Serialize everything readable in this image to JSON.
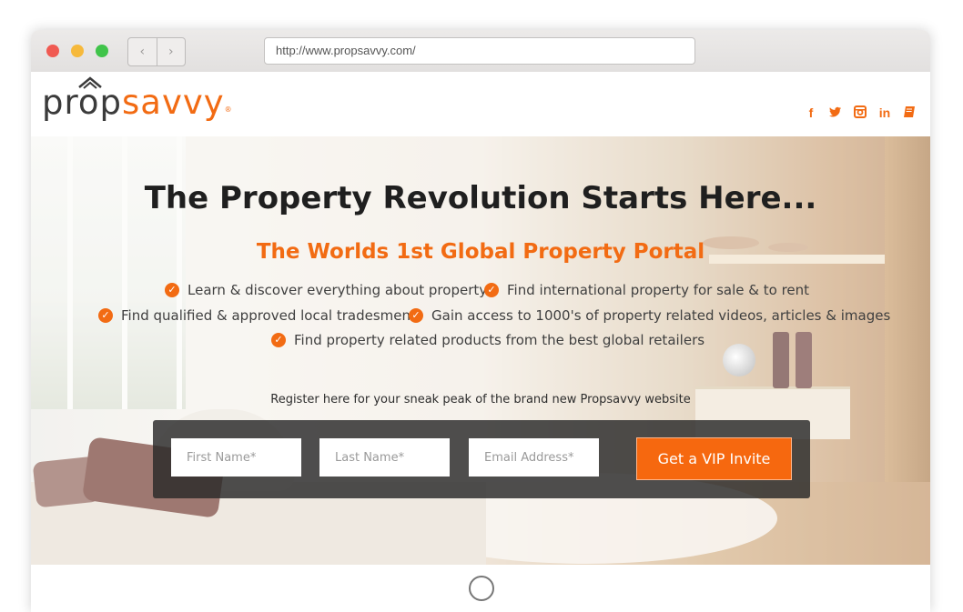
{
  "browser": {
    "url": "http://www.propsavvy.com/",
    "back_glyph": "‹",
    "forward_glyph": "›"
  },
  "site": {
    "logo_part1": "prop",
    "logo_part2": "savvy",
    "logo_mark": "®",
    "brand_color": "#f26b13",
    "social": [
      {
        "icon": "facebook-icon",
        "glyph": "f"
      },
      {
        "icon": "twitter-icon",
        "glyph": "t"
      },
      {
        "icon": "instagram-icon",
        "glyph": "◘"
      },
      {
        "icon": "linkedin-icon",
        "glyph": "in"
      },
      {
        "icon": "book-icon",
        "glyph": "▰"
      }
    ]
  },
  "hero": {
    "headline": "The Property Revolution Starts Here...",
    "subheadline": "The Worlds 1st Global Property Portal",
    "check_glyph": "✓",
    "features": [
      "Learn & discover everything about property",
      "Find international property for sale & to rent",
      "Find qualified & approved local tradesmen",
      "Gain access to 1000's of property related videos, articles & images",
      "Find property related products  from the best global retailers"
    ],
    "register_text": "Register here for your sneak peak of the brand new Propsavvy website"
  },
  "form": {
    "first_name_placeholder": "First Name*",
    "last_name_placeholder": "Last Name*",
    "email_placeholder": "Email Address*",
    "submit_label": "Get a VIP Invite"
  }
}
